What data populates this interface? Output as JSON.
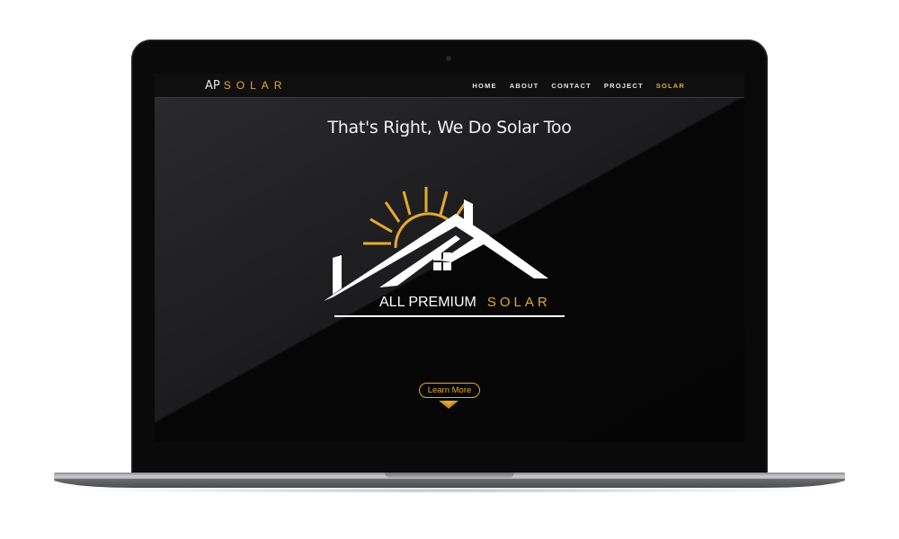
{
  "nav": {
    "logo_ap": "AP",
    "logo_solar": "SOLAR",
    "links": [
      "HOME",
      "ABOUT",
      "CONTACT",
      "PROJECT",
      "SOLAR"
    ],
    "active_link": "SOLAR"
  },
  "hero": {
    "headline": "That's Right, We Do Solar Too",
    "brand_all": "ALL PREMIUM",
    "brand_solar": "SOLAR",
    "learn_more": "Learn More"
  },
  "colors": {
    "accent": "#e7a92c",
    "background": "#050505",
    "text": "#f2f2f2"
  },
  "icons": [
    "sun-icon",
    "house-roof-icon",
    "chevron-down-icon",
    "camera-icon"
  ]
}
